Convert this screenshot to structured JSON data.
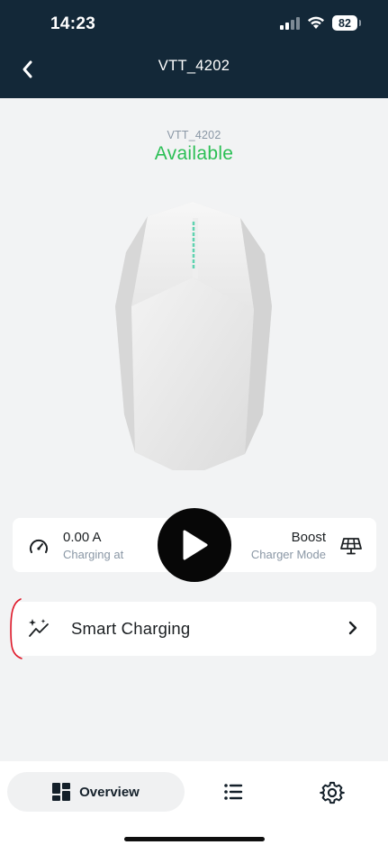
{
  "status_bar": {
    "time": "14:23",
    "battery": "82"
  },
  "nav": {
    "title": "VTT_4202"
  },
  "charger": {
    "id": "VTT_4202",
    "status": "Available",
    "status_color": "#2bbf55"
  },
  "info": {
    "current_value": "0.00 A",
    "current_label": "Charging at",
    "mode_value": "Boost",
    "mode_label": "Charger Mode"
  },
  "smart_charging": {
    "label": "Smart Charging"
  },
  "bottom_nav": {
    "overview_label": "Overview"
  },
  "colors": {
    "header_bg": "#132838",
    "accent_green": "#2bbf55",
    "annotation_red": "#e0192a"
  },
  "icons": [
    "back-arrow-icon",
    "signal-icon",
    "wifi-icon",
    "battery-icon",
    "speedometer-icon",
    "play-icon",
    "solar-panel-icon",
    "sparkle-chart-icon",
    "chevron-right-icon",
    "dashboard-grid-icon",
    "list-icon",
    "gear-icon"
  ]
}
